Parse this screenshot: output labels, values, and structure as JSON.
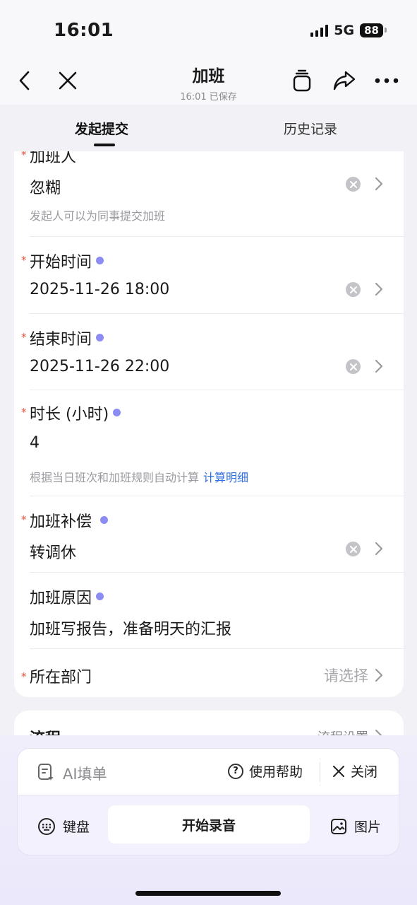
{
  "status_bar": {
    "time": "16:01",
    "network": "5G",
    "battery": "88"
  },
  "nav": {
    "title": "加班",
    "subtitle": "16:01 已保存"
  },
  "tabs": {
    "submit": "发起提交",
    "history": "历史记录"
  },
  "form": {
    "fields": [
      {
        "label": "加班人",
        "required": true,
        "value": "忽糊",
        "hint": "发起人可以为同事提交加班"
      },
      {
        "label": "开始时间",
        "required": true,
        "value": "2025-11-26 18:00"
      },
      {
        "label": "结束时间",
        "required": true,
        "value": "2025-11-26 22:00"
      },
      {
        "label": "时长 (小时)",
        "required": true,
        "value": "4",
        "hint": "根据当日班次和加班规则自动计算",
        "link": "计算明细"
      },
      {
        "label": "加班补偿",
        "required": true,
        "value": "转调休"
      },
      {
        "label": "加班原因",
        "required": false,
        "value": "加班写报告，准备明天的汇报"
      },
      {
        "label": "所在部门",
        "required": true,
        "placeholder": "请选择"
      }
    ],
    "required_mark": "*"
  },
  "process": {
    "title": "流程",
    "settings": "流程设置"
  },
  "ai_panel": {
    "label": "AI填单",
    "help": "使用帮助",
    "close": "关闭",
    "keyboard": "键盘",
    "record": "开始录音",
    "image": "图片"
  },
  "colors": {
    "accent_dot": "#8c8cf5",
    "required": "#e8533a",
    "link": "#2f6fdf"
  }
}
